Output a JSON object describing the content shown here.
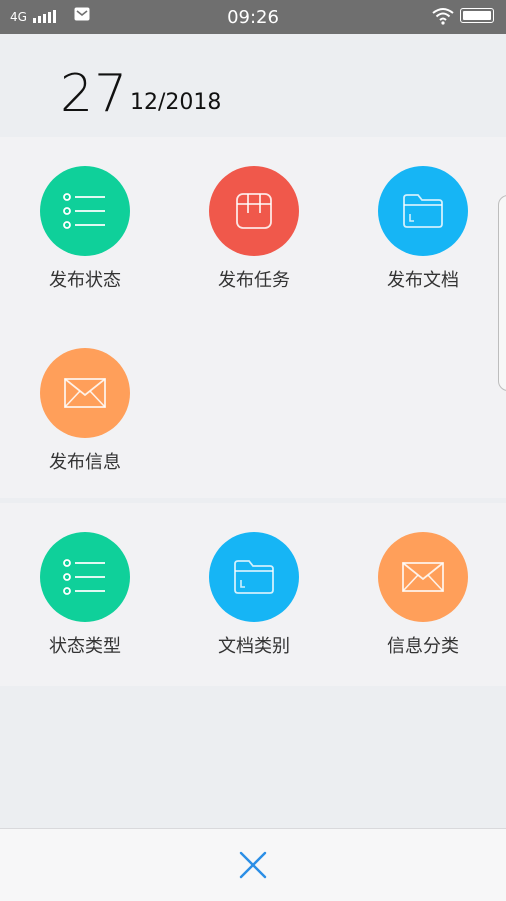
{
  "statusbar": {
    "network": "4G",
    "time": "09:26"
  },
  "date": {
    "day": "27",
    "month_year": "12/2018"
  },
  "colors": {
    "green": "#0fd09a",
    "red": "#f0584b",
    "blue": "#16b5f5",
    "orange": "#ff9f5a",
    "close": "#2b8ee6"
  },
  "publish_section": {
    "items": [
      {
        "label": "发布状态",
        "icon": "list-icon"
      },
      {
        "label": "发布任务",
        "icon": "task-icon"
      },
      {
        "label": "发布文档",
        "icon": "folder-icon"
      },
      {
        "label": "发布信息",
        "icon": "mail-icon"
      }
    ]
  },
  "category_section": {
    "items": [
      {
        "label": "状态类型",
        "icon": "list-icon"
      },
      {
        "label": "文档类别",
        "icon": "folder-icon"
      },
      {
        "label": "信息分类",
        "icon": "mail-icon"
      }
    ]
  },
  "bottom": {
    "close_icon": "close-icon"
  }
}
